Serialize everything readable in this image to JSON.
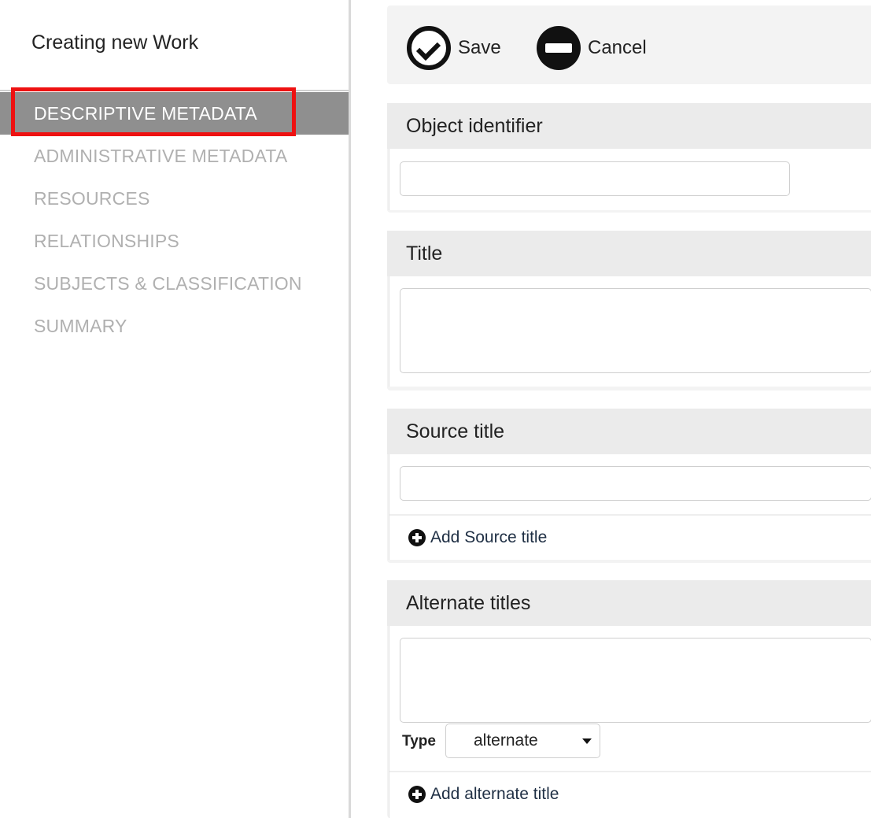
{
  "sidebar": {
    "title": "Creating new Work",
    "items": [
      {
        "label": "DESCRIPTIVE METADATA",
        "active": true
      },
      {
        "label": "ADMINISTRATIVE METADATA",
        "active": false
      },
      {
        "label": "RESOURCES",
        "active": false
      },
      {
        "label": "RELATIONSHIPS",
        "active": false
      },
      {
        "label": "SUBJECTS & CLASSIFICATION",
        "active": false
      },
      {
        "label": "SUMMARY",
        "active": false
      }
    ]
  },
  "toolbar": {
    "save_label": "Save",
    "cancel_label": "Cancel",
    "save_icon": "check-circle-icon",
    "cancel_icon": "minus-circle-icon"
  },
  "panels": {
    "object_identifier": {
      "title": "Object identifier",
      "value": ""
    },
    "title": {
      "title": "Title",
      "value": ""
    },
    "source_title": {
      "title": "Source title",
      "value": "",
      "add_label": "Add Source title"
    },
    "alternate_titles": {
      "title": "Alternate titles",
      "value": "",
      "type_label": "Type",
      "type_value": "alternate",
      "add_label": "Add alternate title"
    }
  },
  "colors": {
    "active_nav_bg": "#8f8f8f",
    "inactive_nav_text": "#b0b0b0",
    "highlight_border": "#ee1111",
    "panel_bg": "#f3f3f3"
  }
}
